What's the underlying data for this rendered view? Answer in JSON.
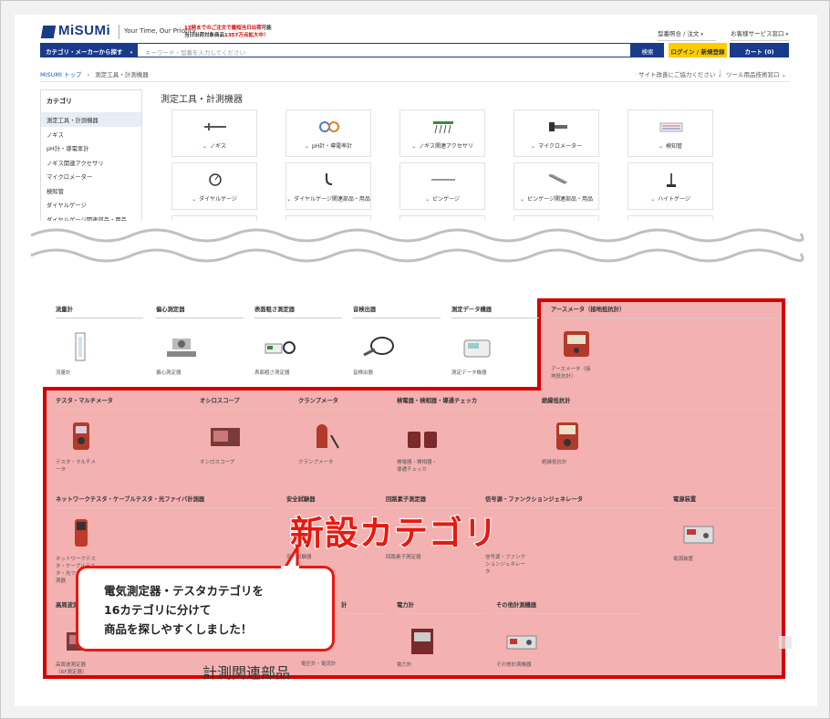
{
  "header": {
    "logo": "MiSUMi",
    "tagline": "Your Time, Our Priority",
    "promo_line1_a": "17時までのご注文で最短",
    "promo_line1_b": "当日出荷",
    "promo_line1_c": "可能",
    "promo_line2_a": "当日出荷対象商品",
    "promo_line2_b": "1357万点",
    "promo_line2_c": "拡大中！",
    "link_model": "型番照合 / 注文",
    "link_service": "お客様サービス窓口",
    "category_button": "カテゴリ・メーカーから探す",
    "search_placeholder": "キーワード・型番を入力してください",
    "search_button": "検索",
    "login_button": "ログイン / 新規登録",
    "cart_button": "カート (0)"
  },
  "breadcrumb": {
    "home": "MISUMI トップ",
    "current": "測定工具・計測機器",
    "help": "サイト改善にご協力ください",
    "tools": "ツール用品技術窓口"
  },
  "sidebar": {
    "title": "カテゴリ",
    "items": [
      "測定工具・計測機器",
      "ノギス",
      "pH計・導電率計",
      "ノギス関連アクセサリ",
      "マイクロメーター",
      "検知管",
      "ダイヤルゲージ",
      "ダイヤルゲージ関連部品・用品"
    ]
  },
  "main": {
    "title": "測定工具・計測機器",
    "tiles": [
      "ノギス",
      "pH計・導電率計",
      "ノギス関連アクセサリ",
      "マイクロメーター",
      "検知管",
      "ダイヤルゲージ",
      "ダイヤルゲージ関連部品・用品",
      "ピンゲージ",
      "ピンゲージ関連部品・用品",
      "ハイトゲージ"
    ]
  },
  "lower": {
    "row1": [
      {
        "title": "流量計",
        "caption": "流量計"
      },
      {
        "title": "偏心測定器",
        "caption": "偏心測定器"
      },
      {
        "title": "表面粗さ測定器",
        "caption": "表面粗さ測定器"
      },
      {
        "title": "音検出器",
        "caption": "音検出器"
      },
      {
        "title": "測定データ機器",
        "caption": "測定データ機器"
      },
      {
        "title": "アースメータ（接地抵抗計）",
        "caption": "アースメータ（接地抵抗計）"
      }
    ],
    "row2": [
      {
        "title": "テスタ・マルチメータ",
        "caption": "テスタ・マルチメータ"
      },
      {
        "title": "オシロスコープ",
        "caption": "オシロスコープ"
      },
      {
        "title": "クランプメータ",
        "caption": "クランプメータ"
      },
      {
        "title": "検電器・検相器・導通チェッカ",
        "caption": "検電器・検相器・導通チェッカ"
      },
      {
        "title": "絶縁抵抗計",
        "caption": "絶縁抵抗計"
      }
    ],
    "row3": [
      {
        "title": "ネットワークテスタ・ケーブルテスタ・光ファイバ計測器",
        "caption": "ネットワークテスタ・ケーブルテスタ・光ファイバ計測器"
      },
      {
        "title": "安全試験器",
        "caption": "安全試験器"
      },
      {
        "title": "回路素子測定器",
        "caption": "回路素子測定器"
      },
      {
        "title": "信号源・ファンクションジェネレータ",
        "caption": "信号源・ファンクションジェネレータ"
      },
      {
        "title": "電源装置",
        "caption": "電源装置"
      }
    ],
    "row4": [
      {
        "title": "高周波測定器",
        "caption": "高周波測定器（RF測定器）"
      },
      {
        "title": "計",
        "caption": "計測関連部品"
      },
      {
        "title": "電力計",
        "caption": "電力計"
      },
      {
        "title": "その他計測機器",
        "caption": "その他計測機器"
      }
    ],
    "row4_extra_caption": "電圧計・電流計"
  },
  "annotation": {
    "headline": "新設カテゴリ",
    "bubble_line1": "電気測定器・テスタカテゴリを",
    "bubble_line2": "16カテゴリに分けて",
    "bubble_line3": "商品を探しやすくしました！"
  },
  "colors": {
    "brand": "#1a3a8a",
    "accent_red": "#e8190f",
    "highlight": "#f3b1b1",
    "login": "#ffcc00"
  }
}
